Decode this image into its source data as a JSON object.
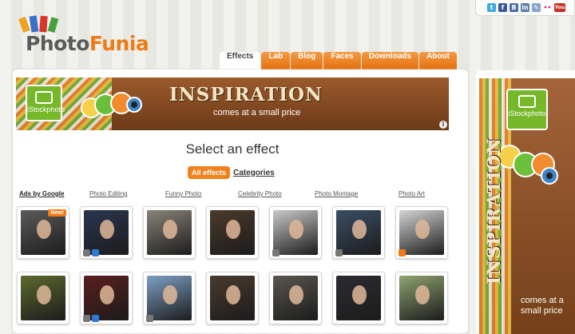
{
  "logo": {
    "part1": "Photo",
    "part2": "Funia"
  },
  "social": [
    "t",
    "f",
    "B",
    "in",
    "✎",
    "••",
    "You"
  ],
  "nav": {
    "tabs": [
      {
        "label": "Effects",
        "active": true
      },
      {
        "label": "Lab"
      },
      {
        "label": "Blog"
      },
      {
        "label": "Faces"
      },
      {
        "label": "Downloads"
      },
      {
        "label": "About"
      }
    ]
  },
  "banner": {
    "brand": "iStockphoto",
    "headline": "INSPIRATION",
    "sub": "comes at a small price",
    "info": "i"
  },
  "heading": "Select an effect",
  "filters": {
    "all": "All effects",
    "categories": "Categories"
  },
  "categories": [
    "Ads by Google",
    "Photo Editing",
    "Funny Photo",
    "Celebrity Photo",
    "Photo Montage",
    "Photo Art"
  ],
  "thumbs_row1": [
    {
      "badge": "New!",
      "color": "#5b5b5b"
    },
    {
      "color": "#2a3550"
    },
    {
      "color": "#8a8478"
    },
    {
      "color": "#4b3a2a"
    },
    {
      "color": "#c9c9c9"
    },
    {
      "color": "#3a4e66"
    },
    {
      "color": "#d4d4d4"
    }
  ],
  "thumbs_row2": [
    {
      "color": "#5c6a2d"
    },
    {
      "color": "#5a1e1e"
    },
    {
      "color": "#7da0c4"
    },
    {
      "color": "#4a3b2f"
    },
    {
      "color": "#5a564f"
    },
    {
      "color": "#2d2a32"
    },
    {
      "color": "#8fa371"
    }
  ],
  "side": {
    "brand": "iStockphoto",
    "headline": "INSPIRATION",
    "tag": "comes at a small price"
  }
}
